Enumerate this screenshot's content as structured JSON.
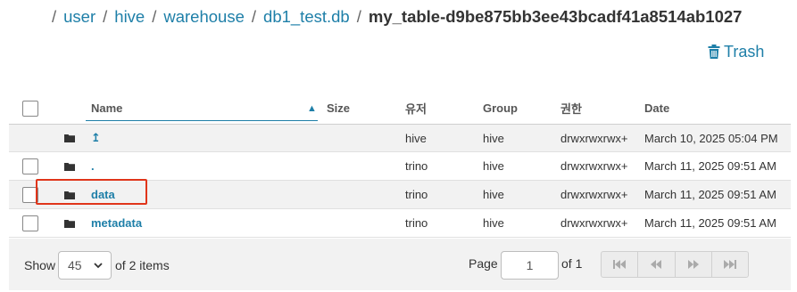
{
  "breadcrumb": {
    "separator": "/",
    "items": [
      "user",
      "hive",
      "warehouse",
      "db1_test.db"
    ],
    "current": "my_table-d9be875bb3ee43bcadf41a8514ab1027"
  },
  "toolbar": {
    "trash_label": "Trash"
  },
  "table": {
    "columns": {
      "name": "Name",
      "size": "Size",
      "user": "유저",
      "group": "Group",
      "permissions": "권한",
      "date": "Date"
    },
    "sort": {
      "column": "Name",
      "direction": "ascending"
    },
    "rows": [
      {
        "name": "↥",
        "size": "",
        "user": "hive",
        "group": "hive",
        "permissions": "drwxrwxrwx+",
        "date": "March 10, 2025 05:04 PM"
      },
      {
        "name": ".",
        "size": "",
        "user": "trino",
        "group": "hive",
        "permissions": "drwxrwxrwx+",
        "date": "March 11, 2025 09:51 AM"
      },
      {
        "name": "data",
        "size": "",
        "user": "trino",
        "group": "hive",
        "permissions": "drwxrwxrwx+",
        "date": "March 11, 2025 09:51 AM"
      },
      {
        "name": "metadata",
        "size": "",
        "user": "trino",
        "group": "hive",
        "permissions": "drwxrwxrwx+",
        "date": "March 11, 2025 09:51 AM"
      }
    ]
  },
  "pagination": {
    "show_label": "Show",
    "page_size": "45",
    "items_label": "of 2 items",
    "page_label": "Page",
    "current_page": "1",
    "of_pages_label": "of 1"
  },
  "colors": {
    "link": "#1e7fa8",
    "highlight": "#e0351a",
    "stripe": "#f2f2f2"
  },
  "icons": {
    "trash": "trash-icon",
    "folder": "folder-icon",
    "sort": "sort-up-icon",
    "first_page": "first-page-icon",
    "prev_page": "prev-page-icon",
    "next_page": "next-page-icon",
    "last_page": "last-page-icon"
  }
}
